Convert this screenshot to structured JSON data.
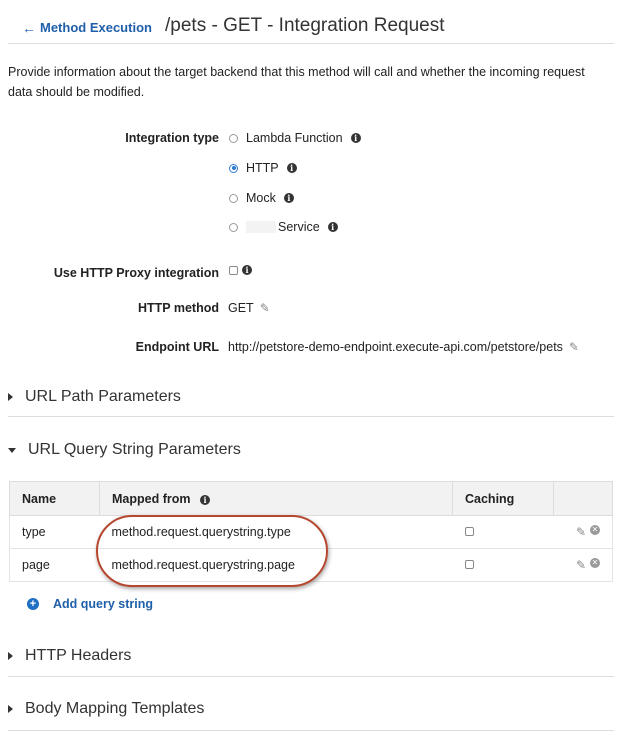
{
  "header": {
    "back_label": "Method Execution",
    "title": "/pets - GET - Integration Request"
  },
  "intro_text": "Provide information about the target backend that this method will call and whether the incoming request data should be modified.",
  "integration": {
    "label": "Integration type",
    "options": [
      {
        "label": "Lambda Function",
        "selected": false
      },
      {
        "label": "HTTP",
        "selected": true
      },
      {
        "label": "Mock",
        "selected": false
      },
      {
        "label": "Service",
        "selected": false
      }
    ]
  },
  "proxy": {
    "label": "Use HTTP Proxy integration",
    "checked": false
  },
  "http_method": {
    "label": "HTTP method",
    "value": "GET"
  },
  "endpoint": {
    "label": "Endpoint URL",
    "value": "http://petstore-demo-endpoint.execute-api.com/petstore/pets"
  },
  "sections": {
    "url_path": "URL Path Parameters",
    "url_query": "URL Query String Parameters",
    "http_headers": "HTTP Headers",
    "body_mapping": "Body Mapping Templates"
  },
  "query_table": {
    "headers": {
      "name": "Name",
      "mapped_from": "Mapped from",
      "caching": "Caching"
    },
    "rows": [
      {
        "name": "type",
        "mapped_from": "method.request.querystring.type",
        "caching": false
      },
      {
        "name": "page",
        "mapped_from": "method.request.querystring.page",
        "caching": false
      }
    ]
  },
  "add_query_label": "Add query string",
  "colors": {
    "link": "#1f5faa",
    "accent": "#2e7bd6",
    "annotation": "#b5472e"
  }
}
